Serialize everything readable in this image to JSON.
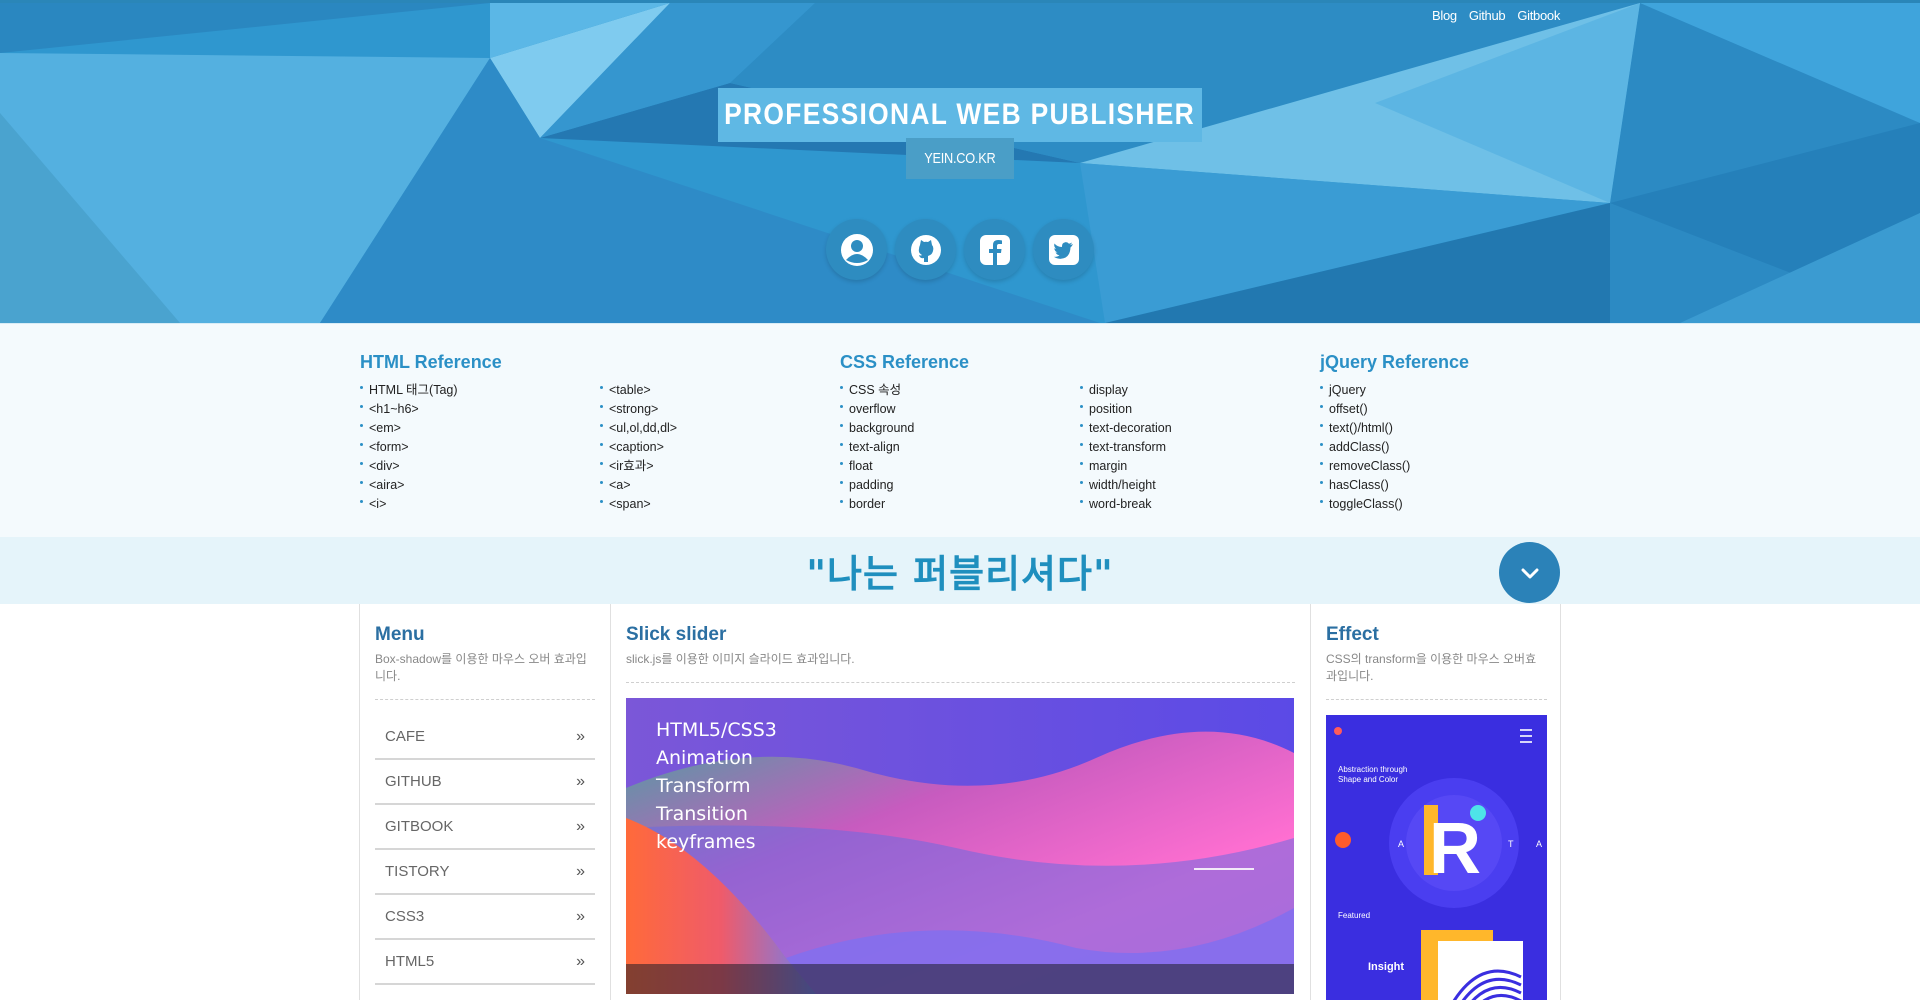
{
  "header": {
    "top_links": [
      "Blog",
      "Github",
      "Gitbook"
    ],
    "title": "PROFESSIONAL WEB PUBLISHER",
    "subtitle": "YEIN.CO.KR",
    "social_icons": [
      "user-icon",
      "github-icon",
      "facebook-icon",
      "twitter-icon"
    ]
  },
  "reference": {
    "html": {
      "title": "HTML Reference",
      "col1": [
        "HTML 태그(Tag)",
        "<h1~h6>",
        "<em>",
        "<form>",
        "<div>",
        "<aira>",
        "<i>"
      ],
      "col2": [
        "<table>",
        "<strong>",
        "<ul,ol,dd,dl>",
        "<caption>",
        "<ir효과>",
        "<a>",
        "<span>"
      ]
    },
    "css": {
      "title": "CSS Reference",
      "col1": [
        "CSS 속성",
        "overflow",
        "background",
        "text-align",
        "float",
        "padding",
        "border"
      ],
      "col2": [
        "display",
        "position",
        "text-decoration",
        "text-transform",
        "margin",
        "width/height",
        "word-break"
      ]
    },
    "jquery": {
      "title": "jQuery Reference",
      "col1": [
        "jQuery",
        "offset()",
        "text()/html()",
        "addClass()",
        "removeClass()",
        "hasClass()",
        "toggleClass()"
      ]
    }
  },
  "slogan": {
    "text": "\"나는 퍼블리셔다\"",
    "down_icon": "chevron-down-icon"
  },
  "menu": {
    "title": "Menu",
    "desc": "Box-shadow를 이용한 마우스 오버 효과입니다.",
    "items": [
      "CAFE",
      "GITHUB",
      "GITBOOK",
      "TISTORY",
      "CSS3",
      "HTML5"
    ],
    "chevron": "»"
  },
  "slider": {
    "title": "Slick slider",
    "desc": "slick.js를 이용한 이미지 슬라이드 효과입니다.",
    "lines": [
      "HTML5/CSS3",
      "Animation",
      "Transform",
      "Transition",
      "keyframes"
    ]
  },
  "effect": {
    "title": "Effect",
    "desc": "CSS의 transform을 이용한 마우스 오버효과입니다.",
    "card": {
      "heading_line1": "Abstraction through",
      "heading_line2": "Shape and Color",
      "letter": "R",
      "side_left": "A",
      "side_right": "T",
      "side_right2": "A",
      "featured": "Featured",
      "insight": "Insight"
    }
  },
  "colors": {
    "accent": "#2b90c6",
    "header_bg": "#2d94cc",
    "slogan_text": "#1f8fbe"
  }
}
